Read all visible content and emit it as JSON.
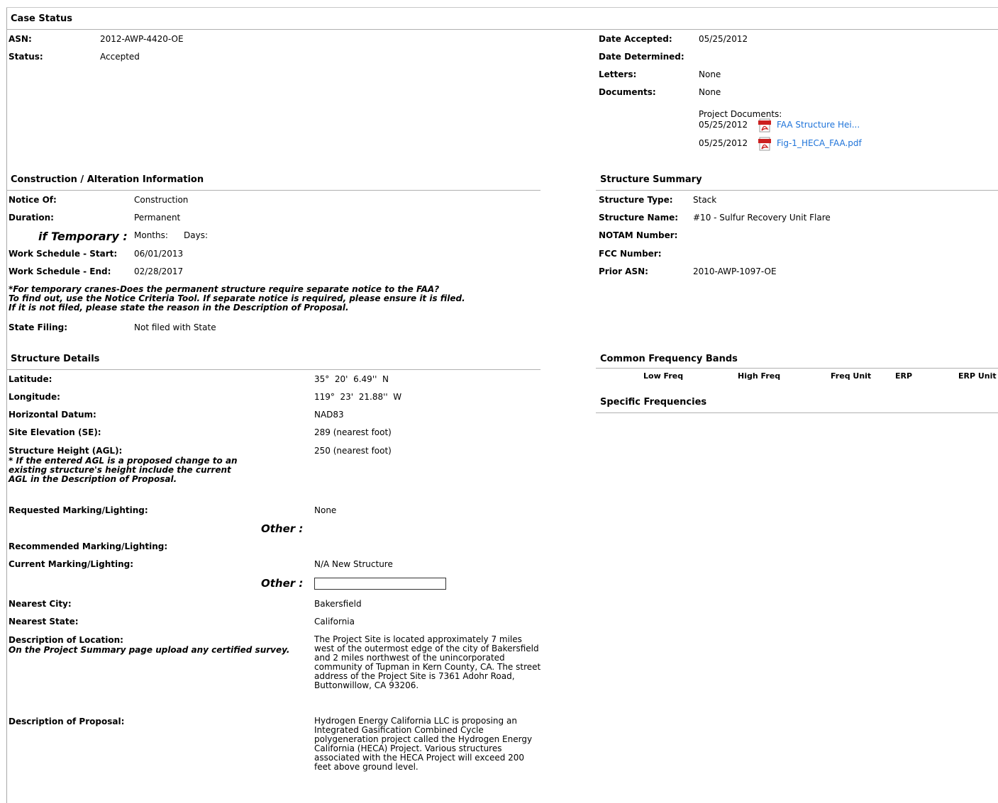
{
  "case_status": {
    "title": "Case Status",
    "asn_label": "ASN:",
    "asn": "2012-AWP-4420-OE",
    "status_label": "Status:",
    "status": "Accepted",
    "date_accepted_label": "Date Accepted:",
    "date_accepted": "05/25/2012",
    "date_determined_label": "Date Determined:",
    "letters_label": "Letters:",
    "letters": "None",
    "documents_label": "Documents:",
    "documents": "None",
    "project_documents_label": "Project Documents:",
    "project_documents": [
      {
        "date": "05/25/2012",
        "name": "FAA Structure Hei..."
      },
      {
        "date": "05/25/2012",
        "name": "Fig-1_HECA_FAA.pdf"
      }
    ]
  },
  "construction": {
    "title": "Construction / Alteration Information",
    "notice_of_label": "Notice Of:",
    "notice_of": "Construction",
    "duration_label": "Duration:",
    "duration": "Permanent",
    "if_temporary_label": "if Temporary :",
    "months_label": "Months:",
    "days_label": "Days:",
    "start_label": "Work Schedule - Start:",
    "start": "06/01/2013",
    "end_label": "Work Schedule - End:",
    "end": "02/28/2017",
    "note_line1": "*For temporary cranes-Does the permanent structure require separate notice to the FAA?",
    "note_line2": "To find out, use the Notice Criteria Tool. If separate notice is required, please ensure it is filed.",
    "note_line3": "If it is not filed, please state the reason in the Description of Proposal.",
    "state_filing_label": "State Filing:",
    "state_filing": "Not filed with State"
  },
  "structure_summary": {
    "title": "Structure Summary",
    "type_label": "Structure Type:",
    "type": "Stack",
    "name_label": "Structure Name:",
    "name": "#10 - Sulfur Recovery Unit Flare",
    "notam_label": "NOTAM Number:",
    "fcc_label": "FCC Number:",
    "prior_asn_label": "Prior ASN:",
    "prior_asn": "2010-AWP-1097-OE"
  },
  "structure_details": {
    "title": "Structure Details",
    "latitude_label": "Latitude:",
    "latitude": "35°  20'  6.49''  N",
    "longitude_label": "Longitude:",
    "longitude": "119°  23'  21.88''  W",
    "datum_label": "Horizontal Datum:",
    "datum": "NAD83",
    "se_label": "Site Elevation (SE):",
    "se": "289 (nearest foot)",
    "agl_label": "Structure Height (AGL):",
    "agl": "250 (nearest foot)",
    "agl_note_line1": "* If the entered AGL is a proposed change to an",
    "agl_note_line2": "existing structure's height include the current",
    "agl_note_line3": "AGL in the Description of Proposal.",
    "requested_label": "Requested Marking/Lighting:",
    "requested": "None",
    "other_label": "Other :",
    "recommended_label": "Recommended Marking/Lighting:",
    "current_label": "Current Marking/Lighting:",
    "current": "N/A New Structure",
    "other_input_value": "",
    "city_label": "Nearest City:",
    "city": "Bakersfield",
    "state_label": "Nearest State:",
    "state": "California",
    "location_label": "Description of Location:",
    "location_note": "On the Project Summary page upload any certified survey.",
    "location": "The Project Site is located approximately 7 miles west of the outermost edge of the city of Bakersfield and 2 miles northwest of the unincorporated community of Tupman in Kern County, CA. The street address of the Project Site is 7361 Adohr Road, Buttonwillow, CA 93206.",
    "proposal_label": "Description of Proposal:",
    "proposal": "Hydrogen Energy California LLC is proposing an Integrated Gasification Combined Cycle polygeneration project called the Hydrogen Energy California (HECA) Project. Various structures associated with the HECA Project will exceed 200 feet above ground level."
  },
  "frequency": {
    "title": "Common Frequency Bands",
    "headers": [
      "Low Freq",
      "High Freq",
      "Freq Unit",
      "ERP",
      "ERP Unit"
    ],
    "specific_title": "Specific Frequencies"
  },
  "icons": {
    "pdf": "pdf-icon"
  },
  "colors": {
    "link": "#1e73d9",
    "pdf_red": "#cc1f1f"
  }
}
